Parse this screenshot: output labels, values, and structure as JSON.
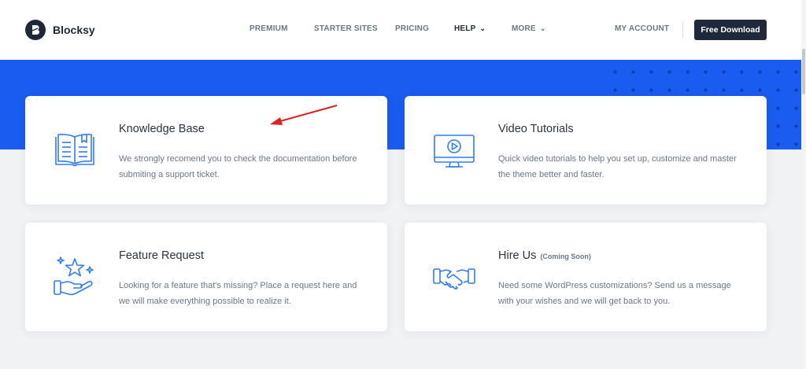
{
  "brand": {
    "name": "Blocksy"
  },
  "nav": {
    "items": [
      {
        "label": "PREMIUM"
      },
      {
        "label": "STARTER SITES"
      },
      {
        "label": "PRICING"
      },
      {
        "label": "HELP"
      },
      {
        "label": "MORE"
      }
    ],
    "account": "MY ACCOUNT",
    "cta": "Free Download"
  },
  "colors": {
    "hero": "#1a5cf0",
    "icon": "#2f7df5",
    "button": "#1e2a3c",
    "annotation": "#e0201e"
  },
  "cards": [
    {
      "title": "Knowledge Base",
      "desc": "We strongly recomend you to check the documentation before submiting a support ticket.",
      "icon": "book-icon"
    },
    {
      "title": "Video Tutorials",
      "desc": "Quick video tutorials to help you set up, customize and master the theme better and faster.",
      "icon": "video-monitor-icon"
    },
    {
      "title": "Feature Request",
      "desc": "Looking for a feature that's missing? Place a request here and we will make everything possible to realize it.",
      "icon": "star-hand-icon"
    },
    {
      "title": "Hire Us",
      "badge": "(Coming Soon)",
      "desc": "Need some WordPress customizations? Send us a message with your wishes and we will get back to you.",
      "icon": "handshake-icon"
    }
  ]
}
